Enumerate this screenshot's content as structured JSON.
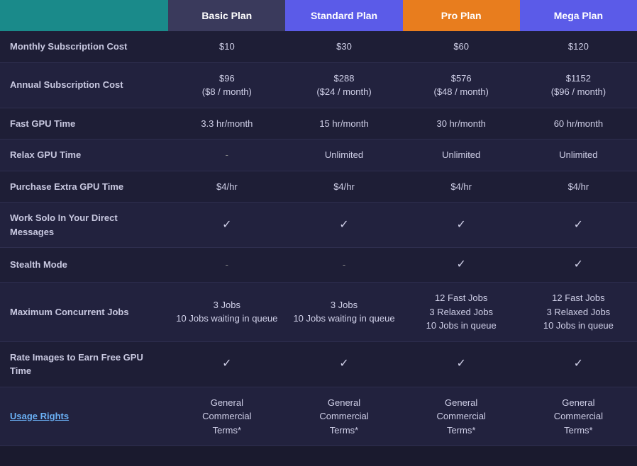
{
  "header": {
    "feature_label": "",
    "basic": "Basic Plan",
    "standard": "Standard Plan",
    "pro": "Pro Plan",
    "mega": "Mega Plan"
  },
  "rows": [
    {
      "feature": "Monthly Subscription Cost",
      "feature_link": false,
      "basic": "$10",
      "standard": "$30",
      "pro": "$60",
      "mega": "$120"
    },
    {
      "feature": "Annual Subscription Cost",
      "feature_link": false,
      "basic": "$96\n($8 / month)",
      "standard": "$288\n($24 / month)",
      "pro": "$576\n($48 / month)",
      "mega": "$1152\n($96 / month)"
    },
    {
      "feature": "Fast GPU Time",
      "feature_link": false,
      "basic": "3.3 hr/month",
      "standard": "15 hr/month",
      "pro": "30 hr/month",
      "mega": "60 hr/month"
    },
    {
      "feature": "Relax GPU Time",
      "feature_link": false,
      "basic": "-",
      "standard": "Unlimited",
      "pro": "Unlimited",
      "mega": "Unlimited"
    },
    {
      "feature": "Purchase Extra GPU Time",
      "feature_link": false,
      "basic": "$4/hr",
      "standard": "$4/hr",
      "pro": "$4/hr",
      "mega": "$4/hr"
    },
    {
      "feature": "Work Solo In Your Direct Messages",
      "feature_link": false,
      "basic": "✓",
      "standard": "✓",
      "pro": "✓",
      "mega": "✓"
    },
    {
      "feature": "Stealth Mode",
      "feature_link": false,
      "basic": "-",
      "standard": "-",
      "pro": "✓",
      "mega": "✓"
    },
    {
      "feature": "Maximum Concurrent Jobs",
      "feature_link": false,
      "basic": "3 Jobs\n10 Jobs waiting in queue",
      "standard": "3 Jobs\n10 Jobs waiting in queue",
      "pro": "12 Fast Jobs\n3 Relaxed Jobs\n10 Jobs in queue",
      "mega": "12 Fast Jobs\n3 Relaxed Jobs\n10 Jobs in queue"
    },
    {
      "feature": "Rate Images to Earn Free GPU Time",
      "feature_link": false,
      "basic": "✓",
      "standard": "✓",
      "pro": "✓",
      "mega": "✓"
    },
    {
      "feature": "Usage Rights",
      "feature_link": true,
      "basic": "General\nCommercial\nTerms*",
      "standard": "General\nCommercial\nTerms*",
      "pro": "General\nCommercial\nTerms*",
      "mega": "General\nCommercial\nTerms*"
    }
  ]
}
